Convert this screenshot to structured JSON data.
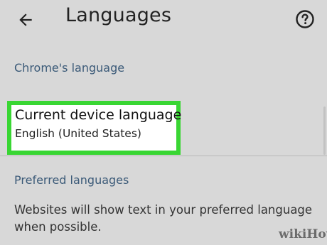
{
  "app_bar": {
    "back_icon": "arrow-left-icon",
    "title": "Languages",
    "help_icon": "help-circle-icon"
  },
  "sections": {
    "chrome_language": {
      "header": "Chrome's language",
      "item_title": "Current device language",
      "item_subtitle": "English (United States)"
    },
    "preferred_languages": {
      "header": "Preferred languages",
      "description": "Websites will show text in your preferred language when possible."
    }
  },
  "watermark": "wikiHow",
  "colors": {
    "highlight_border": "#39d633",
    "section_header": "#3b5a78",
    "background": "#d8d8d8"
  }
}
